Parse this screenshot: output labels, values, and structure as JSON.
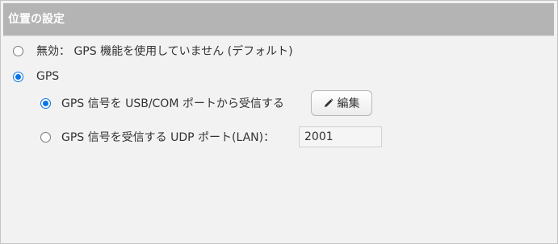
{
  "panel": {
    "title": "位置の設定"
  },
  "options": {
    "disabled": {
      "label": "無効： GPS 機能を使用していません (デフォルト)",
      "checked": false
    },
    "gps": {
      "label": "GPS",
      "checked": true
    },
    "usb_com": {
      "label": "GPS 信号を USB/COM ポートから受信する",
      "checked": true,
      "edit_button_label": "編集",
      "edit_icon": "pencil-icon"
    },
    "udp": {
      "label": "GPS 信号を受信する UDP ポート(LAN)：",
      "checked": false,
      "port_value": "2001"
    }
  },
  "colors": {
    "header_bg": "#b4b4b4",
    "panel_bg": "#f2f2f2",
    "radio_checked": "#0a74e6"
  }
}
